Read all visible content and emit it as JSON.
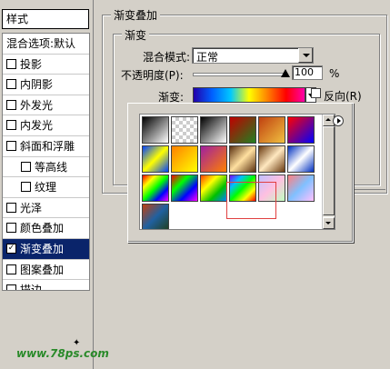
{
  "left_panel": {
    "header": "样式",
    "items": [
      {
        "label": "混合选项:默认",
        "checkbox": false,
        "checked": false,
        "indent": false,
        "selected": false
      },
      {
        "label": "投影",
        "checkbox": true,
        "checked": false,
        "indent": false,
        "selected": false
      },
      {
        "label": "内阴影",
        "checkbox": true,
        "checked": false,
        "indent": false,
        "selected": false
      },
      {
        "label": "外发光",
        "checkbox": true,
        "checked": false,
        "indent": false,
        "selected": false
      },
      {
        "label": "内发光",
        "checkbox": true,
        "checked": false,
        "indent": false,
        "selected": false
      },
      {
        "label": "斜面和浮雕",
        "checkbox": true,
        "checked": false,
        "indent": false,
        "selected": false
      },
      {
        "label": "等高线",
        "checkbox": true,
        "checked": false,
        "indent": true,
        "selected": false
      },
      {
        "label": "纹理",
        "checkbox": true,
        "checked": false,
        "indent": true,
        "selected": false
      },
      {
        "label": "光泽",
        "checkbox": true,
        "checked": false,
        "indent": false,
        "selected": false
      },
      {
        "label": "颜色叠加",
        "checkbox": true,
        "checked": false,
        "indent": false,
        "selected": false
      },
      {
        "label": "渐变叠加",
        "checkbox": true,
        "checked": true,
        "indent": false,
        "selected": true
      },
      {
        "label": "图案叠加",
        "checkbox": true,
        "checked": false,
        "indent": false,
        "selected": false
      },
      {
        "label": "描边",
        "checkbox": true,
        "checked": false,
        "indent": false,
        "selected": false
      }
    ],
    "watermark": "www.78ps.com"
  },
  "panel": {
    "outer_title": "渐变叠加",
    "inner_title": "渐变",
    "blend_mode_label": "混合模式:",
    "blend_mode_value": "正常",
    "opacity_label": "不透明度(P):",
    "opacity_value": "100",
    "opacity_unit": "%",
    "opacity_level": 1.0,
    "gradient_label": "渐变:",
    "reverse_label": "反向(R)",
    "reverse_checked": false
  },
  "picker": {
    "swatches": [
      {
        "bg": "linear-gradient(135deg,#000 0%,#fff 100%)"
      },
      {
        "bg": "repeating-conic-gradient(#ccc 0 25%,#fff 0 50%) 0 0/8px 8px"
      },
      {
        "bg": "linear-gradient(135deg,#000,#fff)"
      },
      {
        "bg": "linear-gradient(135deg,#c00000,#208020)"
      },
      {
        "bg": "linear-gradient(135deg,#c04010,#f0c040)"
      },
      {
        "bg": "linear-gradient(135deg,#ff0000,#0000ff)"
      },
      {
        "bg": "linear-gradient(135deg,#0040ff,#ffff00,#0040ff)"
      },
      {
        "bg": "linear-gradient(135deg,#ff8000,#ffff00)"
      },
      {
        "bg": "linear-gradient(135deg,#a020a0,#ff8000)"
      },
      {
        "bg": "linear-gradient(135deg,#5a3010,#ffe0a0,#5a3010)"
      },
      {
        "bg": "linear-gradient(135deg,#6a3a10,#ffe8c0,#6a3a10)"
      },
      {
        "bg": "linear-gradient(135deg,#0030c0,#ffffff,#0030c0)"
      },
      {
        "bg": "linear-gradient(135deg,#ff0000,#ffff00,#00ff00,#0000ff,#ff00ff)"
      },
      {
        "bg": "linear-gradient(135deg,#ff0000,#00ff00,#0000ff,#ff00ff)"
      },
      {
        "bg": "linear-gradient(135deg,#ff4000,#ffff00,#00c000,#0080ff)"
      },
      {
        "bg": "linear-gradient(135deg,#8000ff,#00c0ff,#00ff00,#ffff00,#ff0000)"
      },
      {
        "bg": "linear-gradient(135deg,#c0c0ff,#ffc0e0,#c0ffc0)"
      },
      {
        "bg": "linear-gradient(135deg,#ff8080,#80c0ff,#ffc0ff)"
      },
      {
        "bg": "linear-gradient(135deg,#c04010,#2060a0,#204020)"
      }
    ]
  }
}
